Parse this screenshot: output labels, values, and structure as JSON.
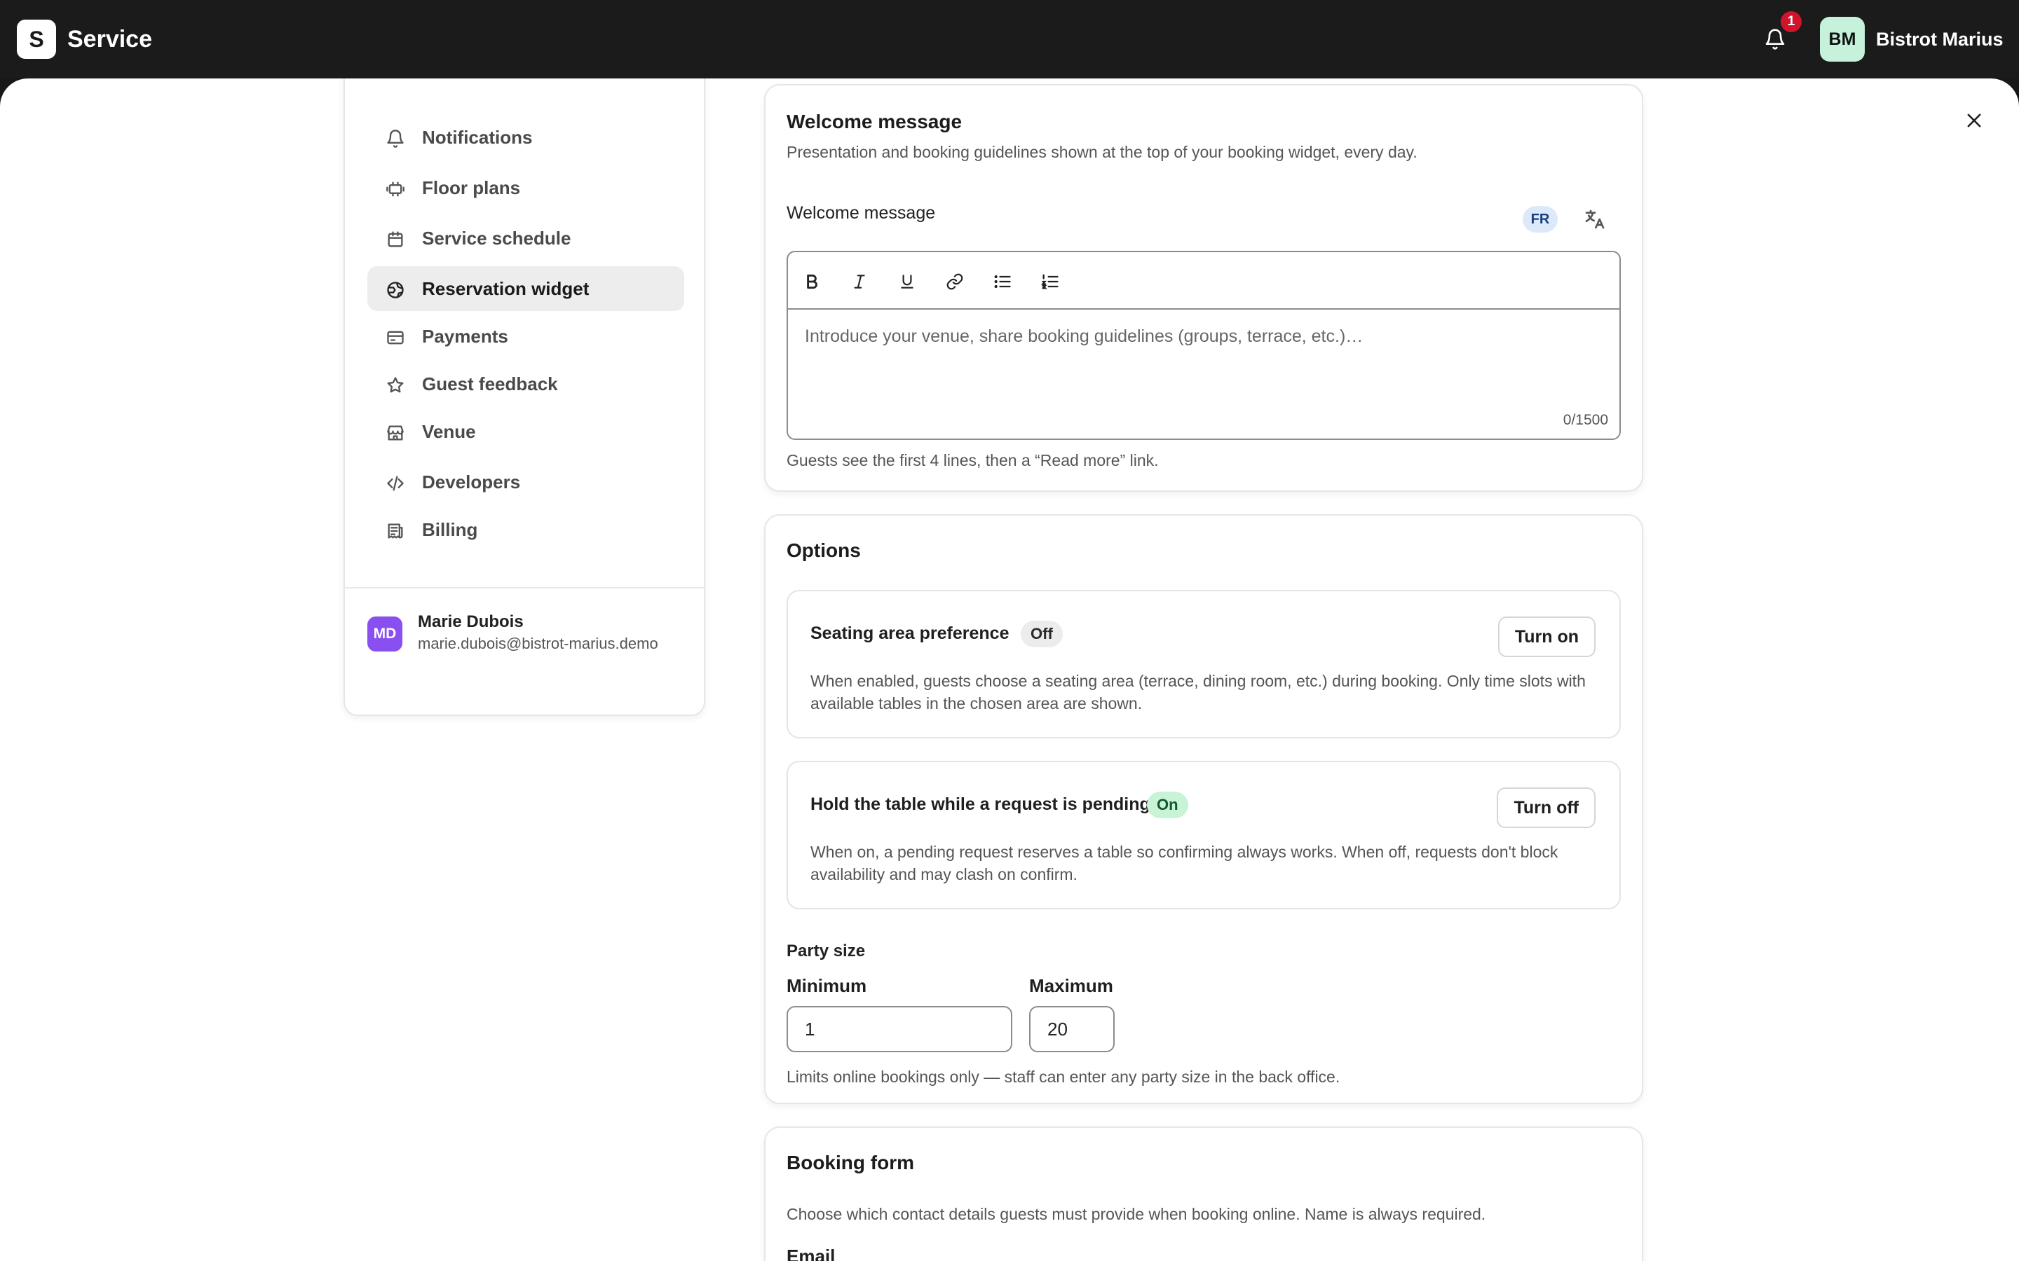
{
  "app": {
    "logo_letter": "S",
    "title": "Service",
    "notification_count": "1",
    "venue_initials": "BM",
    "venue_name": "Bistrot Marius"
  },
  "sidebar": {
    "items": [
      {
        "label": "Notifications",
        "icon": "bell-icon",
        "active": false
      },
      {
        "label": "Floor plans",
        "icon": "floor-plan-icon",
        "active": false
      },
      {
        "label": "Service schedule",
        "icon": "calendar-icon",
        "active": false
      },
      {
        "label": "Reservation widget",
        "icon": "globe-icon",
        "active": true
      },
      {
        "label": "Payments",
        "icon": "credit-card-icon",
        "active": false
      },
      {
        "label": "Guest feedback",
        "icon": "star-icon",
        "active": false
      },
      {
        "label": "Venue",
        "icon": "storefront-icon",
        "active": false
      },
      {
        "label": "Developers",
        "icon": "code-icon",
        "active": false
      },
      {
        "label": "Billing",
        "icon": "receipt-icon",
        "active": false
      }
    ],
    "user": {
      "initials": "MD",
      "name": "Marie Dubois",
      "email": "marie.dubois@bistrot-marius.demo"
    }
  },
  "welcome": {
    "title": "Welcome message",
    "description": "Presentation and booking guidelines shown at the top of your booking widget, every day.",
    "field_label": "Welcome message",
    "language": "FR",
    "placeholder": "Introduce your venue, share booking guidelines (groups, terrace, etc.)…",
    "char_count": "0/1500",
    "helper": "Guests see the first 4 lines, then a “Read more” link."
  },
  "options": {
    "title": "Options",
    "seating": {
      "title": "Seating area preference",
      "status": "Off",
      "button": "Turn on",
      "description": "When enabled, guests choose a seating area (terrace, dining room, etc.) during booking. Only time slots with available tables in the chosen area are shown."
    },
    "hold": {
      "title": "Hold the table while a request is pending",
      "status": "On",
      "button": "Turn off",
      "description": "When on, a pending request reserves a table so confirming always works. When off, requests don't block availability and may clash on confirm."
    },
    "party_size": {
      "label": "Party size",
      "min_label": "Minimum",
      "min_value": "1",
      "max_label": "Maximum",
      "max_value": "20",
      "helper": "Limits online bookings only — staff can enter any party size in the back office."
    }
  },
  "booking_form": {
    "title": "Booking form",
    "description": "Choose which contact details guests must provide when booking online. Name is always required.",
    "email_label": "Email"
  },
  "colors": {
    "topbar": "#1b1b1b",
    "badge_red": "#d0142c",
    "on_green": "#c9f3d6",
    "user_purple": "#8a4ff0"
  }
}
